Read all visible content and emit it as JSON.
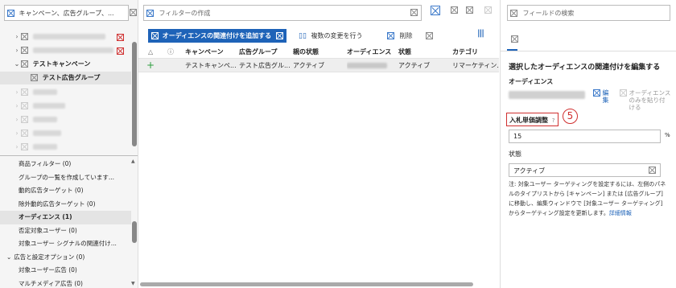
{
  "left": {
    "search_placeholder": "キャンペーン、広告グループ、...",
    "tree": {
      "campaign_label": "テストキャンペーン",
      "adgroup_label": "テスト広告グループ"
    },
    "list_items": [
      "商品フィルター (0)",
      "グループの一覧を作成しています...",
      "動的広告ターゲット (0)",
      "除外動的広告ターゲット (0)",
      "オーディエンス (1)",
      "否定対象ユーザー (0)",
      "対象ユーザー シグナルの関連付け...",
      "広告と設定オプション (0)",
      "対象ユーザー広告 (0)",
      "マルチメディア広告 (0)"
    ]
  },
  "middle": {
    "filter_placeholder": "フィルターの作成",
    "toolbar": {
      "add_label": "オーディエンスの関連付けを追加する",
      "multi_change_label": "複数の変更を行う",
      "delete_label": "削除"
    },
    "columns": [
      "キャンペーン",
      "広告グループ",
      "親の状態",
      "オーディエンス",
      "状態",
      "カテゴリ"
    ],
    "rows": [
      {
        "campaign": "テストキャンペ...",
        "adgroup": "テスト広告グル...",
        "parent_status": "アクティブ",
        "audience": "",
        "status": "アクティブ",
        "category": "リマーケティン..."
      }
    ]
  },
  "right": {
    "search_placeholder": "フィールドの検索",
    "edit_title": "選択したオーディエンスの関連付けを編集する",
    "audience_label": "オーディエンス",
    "edit_link": "編集",
    "paste_only_label": "オーディエンスのみを貼り付ける",
    "bid_label": "入札単価調整",
    "step_number": "5",
    "bid_value": "15",
    "bid_unit": "%",
    "status_label": "状態",
    "status_value": "アクティブ",
    "note_text": "注: 対象ユーザー ターゲティングを設定するには、左側のパネルのタイプリストから [キャンペーン] または [広告グループ] に移動し、編集ウィンドウで [対象ユーザー ターゲティング] からターゲティング設定を更新します。",
    "note_link": "詳細情報"
  },
  "colors": {
    "accent": "#1e63b8",
    "highlight": "#d03030"
  }
}
